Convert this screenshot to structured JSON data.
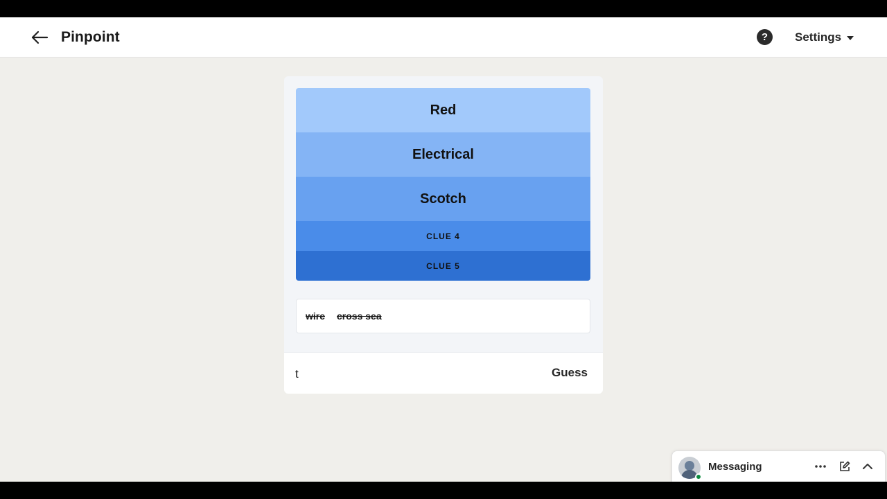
{
  "header": {
    "title": "Pinpoint",
    "help_label": "?",
    "settings_label": "Settings"
  },
  "game": {
    "clues": [
      {
        "label": "Red",
        "revealed": true,
        "color": "#a2c9fb"
      },
      {
        "label": "Electrical",
        "revealed": true,
        "color": "#84b4f5"
      },
      {
        "label": "Scotch",
        "revealed": true,
        "color": "#68a1f0"
      },
      {
        "label": "CLUE 4",
        "revealed": false,
        "color": "#4a8ce9"
      },
      {
        "label": "CLUE 5",
        "revealed": false,
        "color": "#2e70d2"
      }
    ],
    "wrong_guesses": [
      "wire",
      "cross sea"
    ],
    "input_value": "t",
    "guess_label": "Guess"
  },
  "messaging": {
    "label": "Messaging",
    "icons": [
      "more-icon",
      "compose-icon",
      "chevron-up-icon"
    ]
  }
}
